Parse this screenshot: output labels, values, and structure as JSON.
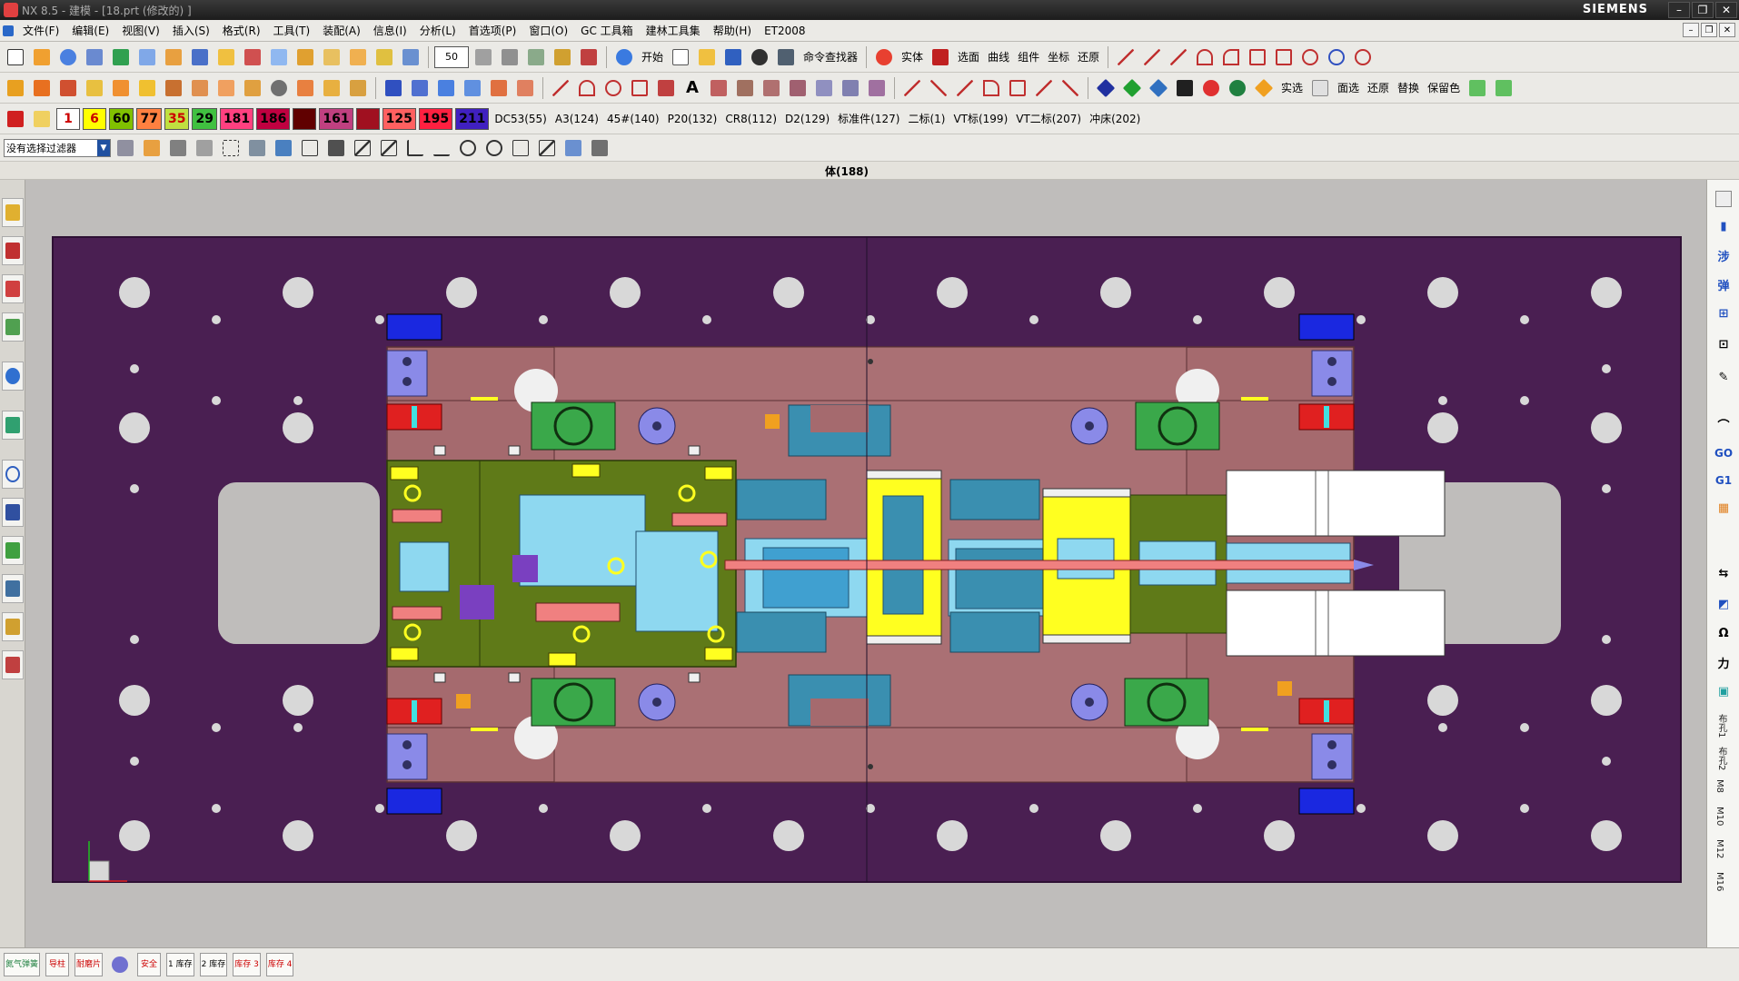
{
  "window": {
    "title": "NX 8.5 - 建模 - [18.prt  (修改的)  ]",
    "brand": "SIEMENS",
    "controls": [
      "–",
      "❐",
      "✕"
    ],
    "doc_controls": [
      "–",
      "❐",
      "✕"
    ]
  },
  "menu": [
    "文件(F)",
    "编辑(E)",
    "视图(V)",
    "插入(S)",
    "格式(R)",
    "工具(T)",
    "装配(A)",
    "信息(I)",
    "分析(L)",
    "首选项(P)",
    "窗口(O)",
    "GC 工具箱",
    "建林工具集",
    "帮助(H)",
    "ET2008"
  ],
  "toolbar1": {
    "zoom_value": "50",
    "start_label": "开始",
    "finder_label": "命令查找器",
    "labels": [
      "实体",
      "选面",
      "曲线",
      "组件",
      "坐标",
      "还原"
    ]
  },
  "toolbar2": {
    "labels": [
      "实选",
      "面选",
      "还原",
      "替换",
      "保留色"
    ]
  },
  "toolbar3": {
    "colors": [
      "1",
      "6",
      "60",
      "77",
      "35",
      "29",
      "181",
      "186",
      "",
      "161",
      "",
      "125",
      "195",
      "211"
    ],
    "color_hex": [
      "#ffffff",
      "#ffff00",
      "#80c000",
      "#ff8040",
      "#c0e040",
      "#40c040",
      "#ff4080",
      "#c00040",
      "#600000",
      "#c04080",
      "#a01020",
      "#ff6060",
      "#ff2040",
      "#4020c0"
    ],
    "materials": [
      "DC53(55)",
      "A3(124)",
      "45#(140)",
      "P20(132)",
      "CR8(112)",
      "D2(129)",
      "标准件(127)",
      "二标(1)",
      "VT标(199)",
      "VT二标(207)",
      "冲床(202)"
    ]
  },
  "toolbar4": {
    "filter": "没有选择过滤器"
  },
  "status_strip": {
    "body_count": "体(188)"
  },
  "rightbar": {
    "labels": [
      "涉",
      "弹",
      "GO",
      "G1",
      "力"
    ],
    "vertical_labels": [
      "布孔1",
      "布孔2",
      "M8",
      "M10",
      "M12",
      "M16"
    ]
  },
  "statusbar": {
    "buttons": [
      "氮气弹簧",
      "导柱",
      "耐磨片",
      "",
      "安全",
      "1 库存",
      "2 库存",
      "库存 3",
      "库存 4"
    ]
  },
  "colors": {
    "purple_plate": "#4a1f52",
    "die_pink": "#a56a6e",
    "olive": "#5f7a18",
    "cyan": "#8ed8f0",
    "steel_blue": "#3a8fb0",
    "yellow": "#ffff20",
    "red": "#e02020",
    "green": "#3aa84a",
    "blue": "#1a28e0",
    "lavender": "#8a8ae8"
  }
}
